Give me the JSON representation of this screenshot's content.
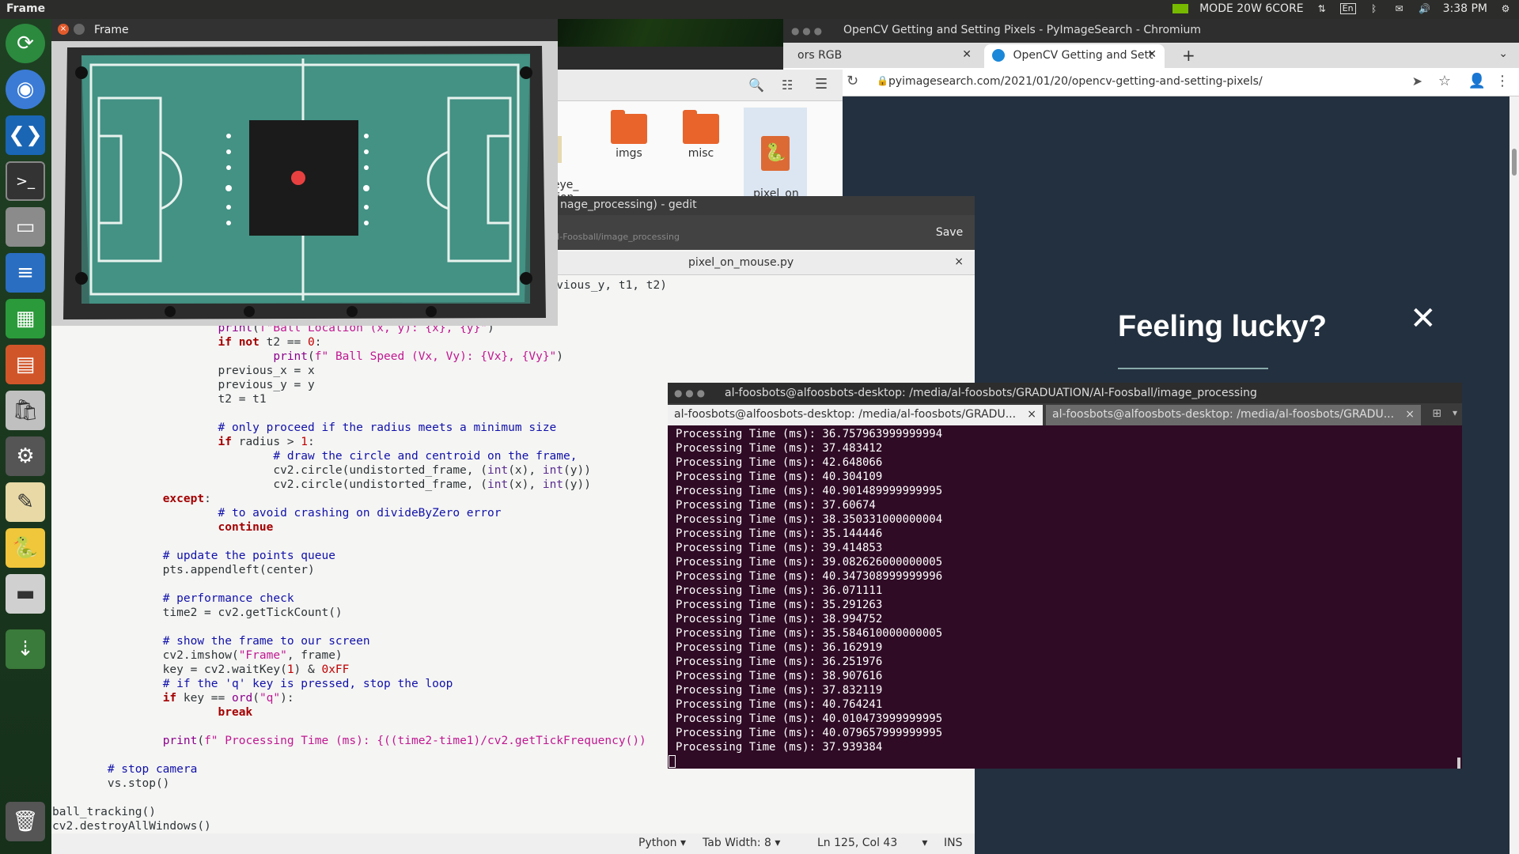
{
  "topbar": {
    "app_name": "Frame",
    "mode": "MODE 20W 6CORE",
    "lang": "En",
    "time": "3:38 PM"
  },
  "launcher": {
    "apps": [
      "software-updater-icon",
      "chromium-icon",
      "vscode-icon",
      "terminal-icon",
      "file-manager-icon",
      "writer-icon",
      "calc-icon",
      "impress-icon",
      "app-store-icon",
      "settings-icon",
      "text-editor-icon",
      "python-icon",
      "disk-icon",
      "usb-icon",
      "trash-icon"
    ]
  },
  "chromium": {
    "window_title": "OpenCV Getting and Setting Pixels - PyImageSearch - Chromium",
    "tab_prev_label": "ors RGB",
    "tab_active_label": "OpenCV Getting and Sett",
    "url": "pyimagesearch.com/2021/01/20/opencv-getting-and-setting-pixels/",
    "popup_title": "Feeling lucky?",
    "popup_close": "✕"
  },
  "files": {
    "items": [
      {
        "label": "eye_\nation.\ny"
      },
      {
        "label": "imgs"
      },
      {
        "label": "misc"
      },
      {
        "label": "pixel_on_\nmouse.py"
      }
    ]
  },
  "gedit": {
    "title": "nage_processing) - gedit",
    "path": "I-Foosball/image_processing",
    "save_label": "Save",
    "tab_label": "pixel_on_mouse.py",
    "tab_close": "×",
    "status_lang": "Python",
    "status_tab": "Tab Width: 8",
    "status_pos": "Ln 125, Col 43",
    "status_mode": "INS"
  },
  "frame_window": {
    "title": "Frame"
  },
  "terminal": {
    "title": "al-foosbots@alfoosbots-desktop: /media/al-foosbots/GRADUATION/AI-Foosball/image_processing",
    "tab1": "al-foosbots@alfoosbots-desktop: /media/al-foosbots/GRADU...",
    "tab2": "al-foosbots@alfoosbots-desktop: /media/al-foosbots/GRADU...",
    "prefix": "Processing Time (ms): ",
    "values": [
      "36.757963999999994",
      "37.483412",
      "42.648066",
      "40.304109",
      "40.901489999999995",
      "37.60674",
      "38.350331000000004",
      "35.144446",
      "39.414853",
      "39.082626000000005",
      "40.347308999999996",
      "36.071111",
      "35.291263",
      "38.994752",
      "35.584610000000005",
      "36.162919",
      "36.251976",
      "38.907616",
      "37.832119",
      "40.764241",
      "40.010473999999995",
      "40.079657999999995",
      "37.939384"
    ]
  }
}
